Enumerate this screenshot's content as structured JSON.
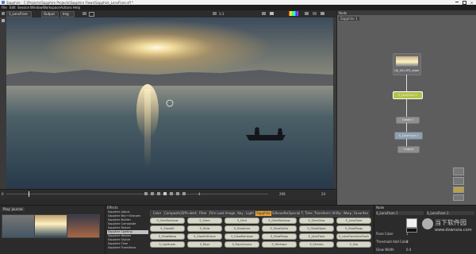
{
  "window": {
    "title": "Sapphire - C:\\Projects\\Sapphire Projects\\Sapphire Flows\\Sapphire_LensFlare.sfl *"
  },
  "menu": [
    "File",
    "Edit",
    "Session",
    "Window",
    "Workspace",
    "Actions",
    "Help"
  ],
  "toolbar": {
    "clip_select": "1_LensFlare",
    "output_select": "Output",
    "mode_select": "Img",
    "zoom": "1:1"
  },
  "node_panel": {
    "title": "Node",
    "dropdown": "Sapphire 1",
    "nodes": [
      {
        "label": "DJI_001.JPG_slider"
      },
      {
        "label": "S_LensFlare 1"
      },
      {
        "label": "Grade 1"
      },
      {
        "label": "S_ColorFuse 1"
      },
      {
        "label": "Output"
      }
    ]
  },
  "timeline": {
    "frame_start": "0",
    "frame_current": "4",
    "frame_end": "296",
    "fps": "24"
  },
  "clip_panel": {
    "dropdown": "Play: Journal"
  },
  "effects_panel": {
    "title": "Effects",
    "categories": [
      "Adjust",
      "Blur+Sharpen",
      "Builder",
      "Composite",
      "Distort",
      "Lighting",
      "Render",
      "Stylize",
      "Time",
      "Transitions"
    ],
    "list": [
      "Sapphire Adjust",
      "Sapphire Blur+Sharpen",
      "Sapphire Builder",
      "Sapphire Composite",
      "Sapphire Distort",
      "Sapphire Lighting",
      "Sapphire Render",
      "Sapphire Stylize",
      "Sapphire Time",
      "Sapphire Transitions"
    ],
    "selected_index": 5,
    "tabs": [
      "Color",
      "Composite",
      "Diff+alert",
      "Filter",
      "Film Look",
      "Image",
      "Key",
      "Light",
      "Sapphire",
      "Silhouette",
      "Special FX",
      "Time",
      "Transform",
      "Utility",
      "Warp",
      "Favorites"
    ],
    "active_tab": 8,
    "buttons": [
      "S_GlintRainbow",
      "S_Glare",
      "S_Glint",
      "S_GlintRainbow",
      "S_GlintGlow",
      "S_LensFlare",
      "S_GlowAlt",
      "S_Glow",
      "S_GlowAura",
      "S_GlowDarks",
      "S_GlowEdges",
      "S_GlowRings",
      "S_GlowNoise",
      "S_GlowOrthicon",
      "S_GlowRainbow",
      "S_GlowRings",
      "S_LensFlare",
      "S_LensFlareAutoTrack",
      "S_LightLeak",
      "S_Rays",
      "S_RaysCorona",
      "S_Reshape",
      "S_Streaks",
      "S_Zap"
    ]
  },
  "params_panel": {
    "title": "Node",
    "dropdown_left": "S_LensFlare 1",
    "dropdown_right": "S_LensFlare 1",
    "params": [
      {
        "label": "Flare Color",
        "value": "1"
      },
      {
        "label": "Threshold Add Color",
        "value": "0"
      },
      {
        "label": "Glow Width",
        "value": "0.4"
      }
    ]
  },
  "watermark": {
    "brand": "当下软件园",
    "url": "www.downxia.com"
  }
}
